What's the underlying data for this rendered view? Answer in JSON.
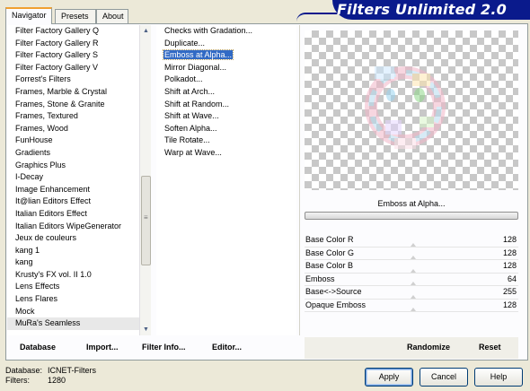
{
  "tabs": [
    "Navigator",
    "Presets",
    "About"
  ],
  "logo_text": "Filters Unlimited 2.0",
  "categories": [
    "Filter Factory Gallery Q",
    "Filter Factory Gallery R",
    "Filter Factory Gallery S",
    "Filter Factory Gallery V",
    "Forrest's Filters",
    "Frames, Marble & Crystal",
    "Frames, Stone & Granite",
    "Frames, Textured",
    "Frames, Wood",
    "FunHouse",
    "Gradients",
    "Graphics Plus",
    "I-Decay",
    "Image Enhancement",
    "It@lian Editors Effect",
    "Italian Editors Effect",
    "Italian Editors WipeGenerator",
    "Jeux de couleurs",
    "kang 1",
    "kang",
    "Krusty's FX vol. II 1.0",
    "Lens Effects",
    "Lens Flares",
    "Mock",
    "MuRa's Seamless"
  ],
  "selected_category": "MuRa's Seamless",
  "filters": [
    "Checks with Gradation...",
    "Duplicate...",
    "Emboss at Alpha...",
    "Mirror Diagonal...",
    "Polkadot...",
    "Shift at Arch...",
    "Shift at Random...",
    "Shift at Wave...",
    "Soften Alpha...",
    "Tile Rotate...",
    "Warp at Wave..."
  ],
  "selected_filter": "Emboss at Alpha...",
  "preview_filter_name": "Emboss at Alpha...",
  "parameters": [
    {
      "label": "Base Color R",
      "value": "128"
    },
    {
      "label": "Base Color G",
      "value": "128"
    },
    {
      "label": "Base Color B",
      "value": "128"
    },
    {
      "label": "Emboss",
      "value": "64"
    },
    {
      "label": "Base<->Source",
      "value": "255"
    },
    {
      "label": "Opaque Emboss",
      "value": "128"
    }
  ],
  "actions": {
    "database": "Database",
    "import": "Import...",
    "filter_info": "Filter Info...",
    "editor": "Editor...",
    "randomize": "Randomize",
    "reset": "Reset"
  },
  "status": {
    "database_label": "Database:",
    "database_value": "ICNET-Filters",
    "filters_label": "Filters:",
    "filters_value": "1280"
  },
  "buttons": {
    "apply": "Apply",
    "cancel": "Cancel",
    "help": "Help"
  },
  "colors": {
    "banner": "#0a1a8c",
    "selection": "#316ac5"
  }
}
